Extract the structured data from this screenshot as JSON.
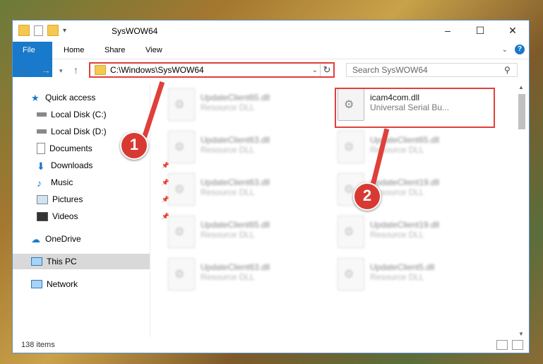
{
  "window": {
    "title": "SysWOW64"
  },
  "ribbon": {
    "tabs": [
      "File",
      "Home",
      "Share",
      "View"
    ]
  },
  "address": {
    "path": "C:\\Windows\\SysWOW64"
  },
  "search": {
    "placeholder": "Search SysWOW64"
  },
  "sidebar": {
    "items": [
      {
        "label": "Quick access",
        "icon": "star-icon"
      },
      {
        "label": "Local Disk (C:)",
        "icon": "drive-icon"
      },
      {
        "label": "Local Disk (D:)",
        "icon": "drive-icon"
      },
      {
        "label": "Documents",
        "icon": "documents-icon"
      },
      {
        "label": "Downloads",
        "icon": "downloads-icon"
      },
      {
        "label": "Music",
        "icon": "music-icon"
      },
      {
        "label": "Pictures",
        "icon": "pictures-icon"
      },
      {
        "label": "Videos",
        "icon": "videos-icon"
      },
      {
        "label": "OneDrive",
        "icon": "cloud-icon"
      },
      {
        "label": "This PC",
        "icon": "computer-icon"
      },
      {
        "label": "Network",
        "icon": "network-icon"
      }
    ]
  },
  "files": [
    {
      "name": "UpdateClient65.dll",
      "desc": "Resource DLL"
    },
    {
      "name": "icam4com.dll",
      "desc": "Universal Serial Bu..."
    },
    {
      "name": "UpdateClient63.dll",
      "desc": "Resource DLL"
    },
    {
      "name": "UpdateClient65.dll",
      "desc": "Resource DLL"
    },
    {
      "name": "UpdateClient63.dll",
      "desc": "Resource DLL"
    },
    {
      "name": "UpdateClient19.dll",
      "desc": "Resource DLL"
    },
    {
      "name": "UpdateClient65.dll",
      "desc": "Resource DLL"
    },
    {
      "name": "UpdateClient19.dll",
      "desc": "Resource DLL"
    },
    {
      "name": "UpdateClient63.dll",
      "desc": "Resource DLL"
    },
    {
      "name": "UpdateClient5.dll",
      "desc": "Resource DLL"
    }
  ],
  "status": {
    "count": "138 items"
  },
  "markers": [
    "1",
    "2"
  ],
  "colors": {
    "accent": "#1979ca",
    "highlight": "#e0403a"
  }
}
